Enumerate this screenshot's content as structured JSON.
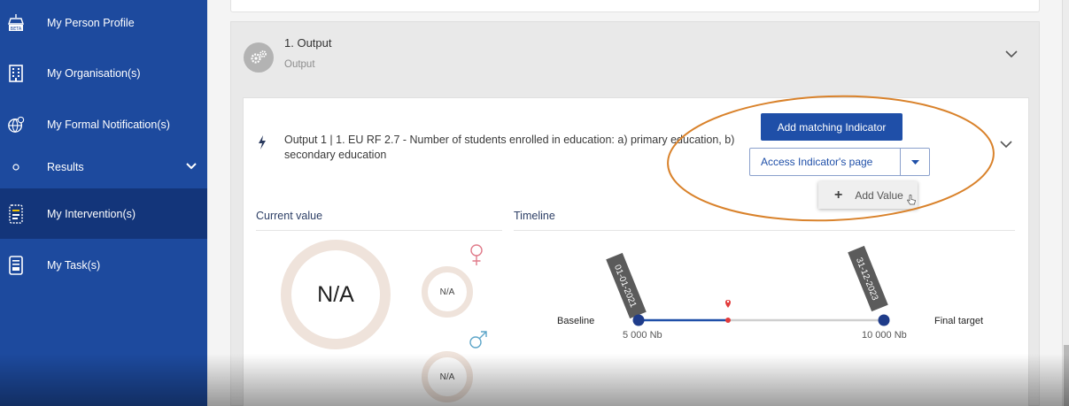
{
  "sidebar": {
    "items": [
      {
        "label": "My Person Profile",
        "icon": "beta-badge-icon"
      },
      {
        "label": "My Organisation(s)",
        "icon": "building-icon"
      },
      {
        "label": "My Formal Notification(s)",
        "icon": "globe-notification-icon"
      },
      {
        "label": "Results",
        "icon": "bullet-icon"
      },
      {
        "label": "My Intervention(s)",
        "icon": "intervention-doc-icon"
      },
      {
        "label": "My Task(s)",
        "icon": "task-doc-icon"
      }
    ],
    "colors": {
      "background": "#1d4a9e",
      "active": "#13357a"
    }
  },
  "section": {
    "title": "1. Output",
    "subtitle": "Output"
  },
  "output": {
    "title": "Output 1 | 1. EU RF 2.7 - Number of students enrolled in education: a) primary education, b) secondary education",
    "add_indicator_label": "Add matching Indicator",
    "access_indicator_label": "Access Indicator's page",
    "add_value_label": "Add Value"
  },
  "current_value": {
    "heading": "Current value",
    "total": "N/A",
    "female": "N/A",
    "male": "N/A"
  },
  "timeline": {
    "heading": "Timeline",
    "baseline_label": "Baseline",
    "final_label": "Final target",
    "baseline_value": "5 000 Nb",
    "final_value": "10 000 Nb",
    "start_date": "01-01-2021",
    "end_date": "31-12-2023"
  },
  "accent_color": "#1f4fa8",
  "annotation_color": "#d9822b"
}
